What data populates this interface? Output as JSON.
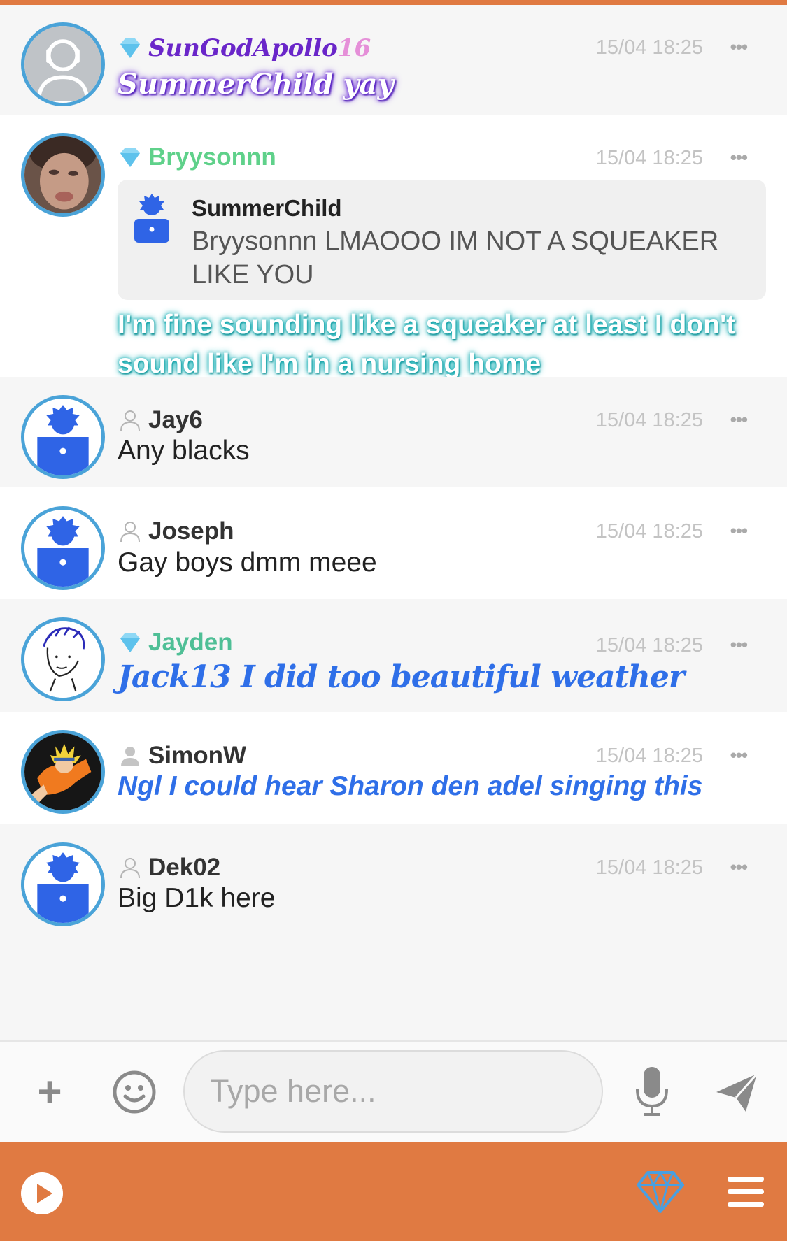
{
  "colors": {
    "accent": "#e07a42",
    "avatar_ring": "#4aa3d8",
    "default_avatar_blue": "#2f64e6"
  },
  "messages": [
    {
      "username_prefix": "SunGodApollo",
      "username_suffix": "16",
      "badge": "diamond-icon",
      "time": "15/04 18:25",
      "text": "SummerChild yay"
    },
    {
      "username": "Bryysonnn",
      "badge": "diamond-icon",
      "time": "15/04 18:25",
      "quote": {
        "name": "SummerChild",
        "text": "Bryysonnn LMAOOO IM NOT A SQUEAKER LIKE YOU"
      },
      "text": "I'm fine sounding like a squeaker at least I don't sound like I'm in a nursing home"
    },
    {
      "username": "Jay6",
      "badge": "user-outline-icon",
      "time": "15/04 18:25",
      "text": "Any blacks"
    },
    {
      "username": "Joseph",
      "badge": "user-outline-icon",
      "time": "15/04 18:25",
      "text": "Gay boys dmm meee"
    },
    {
      "username": "Jayden",
      "badge": "diamond-icon",
      "time": "15/04 18:25",
      "text": "Jack13 I did too beautiful weather"
    },
    {
      "username": "SimonW",
      "badge": "user-filled-icon",
      "time": "15/04 18:25",
      "text": "Ngl I could hear Sharon den adel singing this"
    },
    {
      "username": "Dek02",
      "badge": "user-outline-icon",
      "time": "15/04 18:25",
      "text": "Big D1k here"
    }
  ],
  "more_label": "•••",
  "composer": {
    "plus_label": "+",
    "placeholder": "Type here..."
  }
}
